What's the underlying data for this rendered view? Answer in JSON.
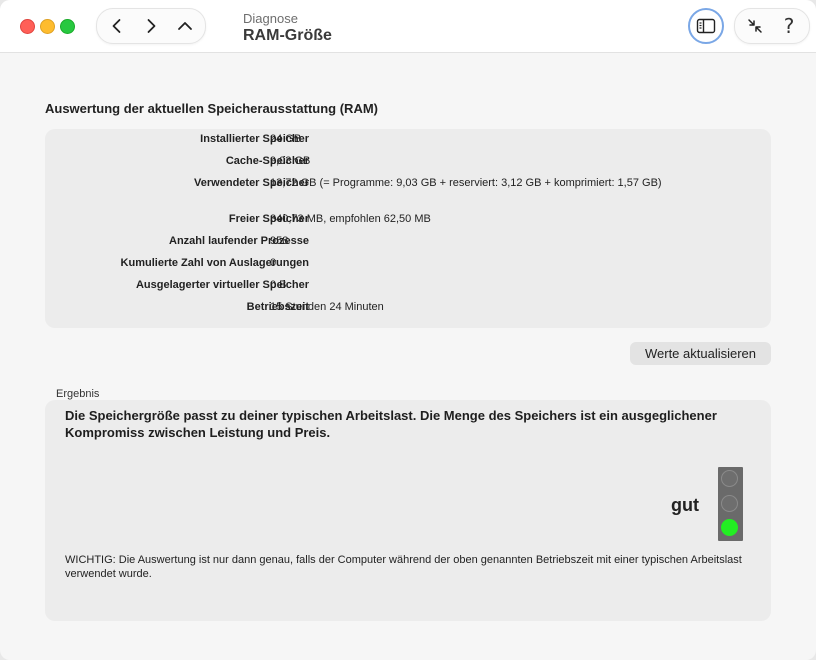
{
  "window": {
    "subtitle": "Diagnose",
    "title": "RAM-Größe"
  },
  "toolbar": {
    "back_icon": "chevron-left-icon",
    "forward_icon": "chevron-right-icon",
    "up_icon": "chevron-up-icon",
    "sidebar_icon": "sidebar-icon",
    "collapse_icon": "collapse-arrows-icon",
    "help_label": "?"
  },
  "ram": {
    "heading": "Auswertung der aktuellen Speicherausstattung (RAM)",
    "rows": [
      {
        "label": "Installierter Speicher",
        "value": "24 GB"
      },
      {
        "label": "Cache-Speicher",
        "value": "9,03 GB"
      },
      {
        "label": "Verwendeter Speicher",
        "value": "13,72 GB (= Programme: 9,03 GB + reserviert: 3,12 GB + komprimiert: 1,57 GB)"
      },
      {
        "label": "Freier Speicher",
        "value": "340,73 MB, empfohlen 62,50 MB"
      },
      {
        "label": "Anzahl laufender Prozesse",
        "value": "958"
      },
      {
        "label": "Kumulierte Zahl von Auslagerungen",
        "value": "0"
      },
      {
        "label": "Ausgelagerter virtueller Speicher",
        "value": "0  B"
      },
      {
        "label": "Betriebszeit",
        "value": "15 Stunden 24 Minuten"
      }
    ],
    "refresh_label": "Werte aktualisieren"
  },
  "result": {
    "label": "Ergebnis",
    "verdict": "Die Speichergröße passt zu deiner typischen Arbeitslast. Die Menge des Speichers ist ein ausgeglichener Kompromiss zwischen Leistung und Preis.",
    "rating": "gut",
    "active_lamp_color": "#22ee22",
    "note": "WICHTIG: Die Auswertung ist nur dann genau, falls der Computer während der oben genannten Betriebszeit mit einer typischen Arbeitslast verwendet wurde."
  }
}
